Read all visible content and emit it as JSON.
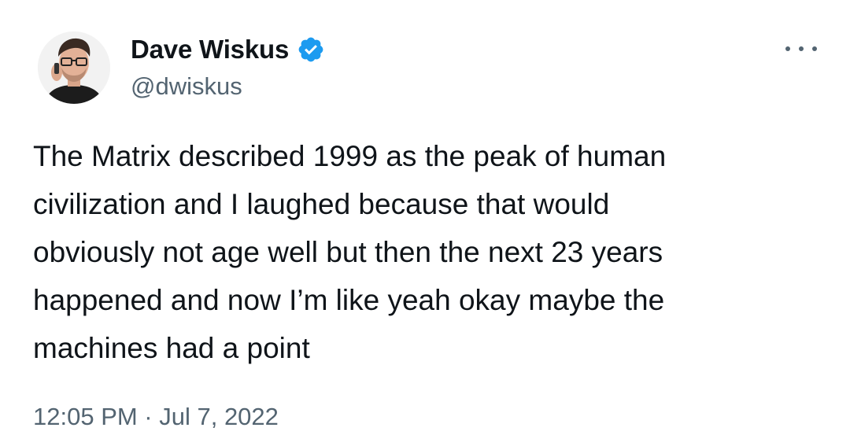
{
  "author": {
    "display_name": "Dave Wiskus",
    "handle": "@dwiskus",
    "verified": true,
    "verified_color": "#1d9bf0"
  },
  "tweet": {
    "text": "The Matrix described 1999 as the peak of human\ncivilization and I laughed because that would\nobviously not age well but then the next 23 years\nhappened and now I’m like yeah okay maybe the\nmachines had a point",
    "timestamp": "12:05 PM · Jul 7, 2022"
  },
  "icons": {
    "verified": "verified-badge-icon",
    "more": "more-options-icon"
  },
  "colors": {
    "text_primary": "#0f1419",
    "text_secondary": "#536471",
    "background": "#ffffff"
  }
}
